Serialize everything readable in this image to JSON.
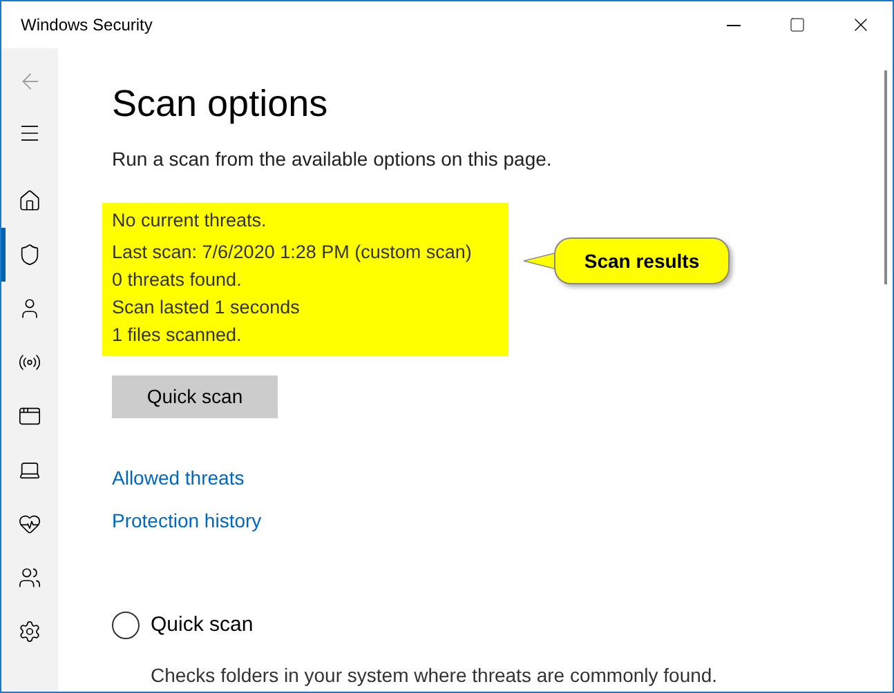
{
  "window": {
    "title": "Windows Security"
  },
  "sidebar": {
    "back_disabled": true,
    "items": [
      {
        "kind": "menu",
        "selected": false
      },
      {
        "kind": "home",
        "selected": false
      },
      {
        "kind": "shield",
        "selected": true
      },
      {
        "kind": "account",
        "selected": false
      },
      {
        "kind": "network",
        "selected": false
      },
      {
        "kind": "app",
        "selected": false
      },
      {
        "kind": "device",
        "selected": false
      },
      {
        "kind": "health",
        "selected": false
      },
      {
        "kind": "family",
        "selected": false
      },
      {
        "kind": "settings",
        "selected": false
      }
    ]
  },
  "page": {
    "title": "Scan options",
    "description": "Run a scan from the available options on this page.",
    "scan_status": [
      "No current threats.",
      "Last scan: 7/6/2020 1:28 PM (custom scan)",
      "0 threats found.",
      "Scan lasted 1 seconds",
      "1 files scanned."
    ],
    "callout": "Scan results",
    "button": "Quick scan",
    "links": [
      "Allowed threats",
      "Protection history"
    ],
    "options": [
      {
        "label": "Quick scan",
        "selected": false,
        "description": "Checks folders in your system where threats are commonly found."
      }
    ]
  }
}
